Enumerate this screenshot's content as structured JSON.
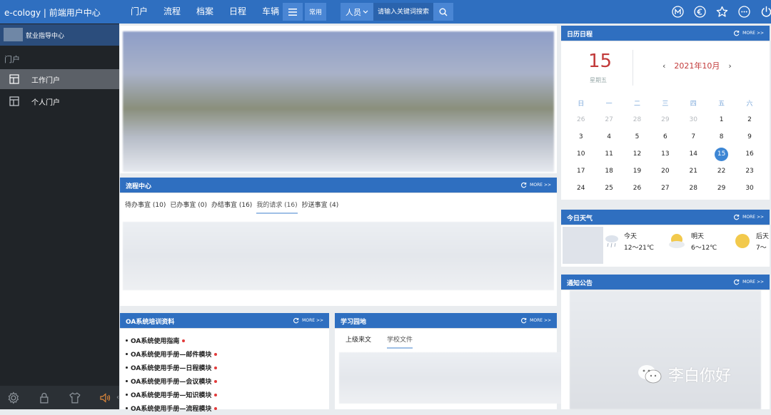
{
  "topbar": {
    "brand": "e-cology | 前端用户中心",
    "nav": [
      "门户",
      "流程",
      "档案",
      "日程",
      "车辆"
    ],
    "common_label": "常用",
    "search_type": "人员",
    "search_placeholder": "请输入关键词搜索",
    "icons": [
      "m-circle-icon",
      "euro-circle-icon",
      "star-icon",
      "more-circle-icon",
      "power-icon"
    ]
  },
  "sidebar": {
    "header": "就业指导中心",
    "section": "门户",
    "items": [
      {
        "label": "工作门户",
        "active": true
      },
      {
        "label": "个人门户",
        "active": false
      }
    ],
    "bottom_icons": [
      "settings-icon",
      "lock-icon",
      "shirt-icon",
      "speaker-icon"
    ]
  },
  "workflow": {
    "title": "流程中心",
    "more": "MORE >>",
    "tabs": [
      "待办事宜 (10)",
      "已办事宜 (0)",
      "办结事宜 (16)",
      "我的请求 (16)",
      "抄送事宜 (4)"
    ],
    "active_tab": 3
  },
  "oa_training": {
    "title": "OA系统培训资料",
    "more": "MORE >>",
    "items": [
      "OA系统使用指南",
      "OA系统使用手册—邮件模块",
      "OA系统使用手册—日程模块",
      "OA系统使用手册—会议模块",
      "OA系统使用手册—知识模块",
      "OA系统使用手册—流程模块"
    ]
  },
  "study": {
    "title": "学习园地",
    "more": "MORE >>",
    "tabs": [
      "上级来文",
      "学校文件"
    ],
    "active_tab": 1
  },
  "calendar": {
    "title": "日历日程",
    "more": "MORE >>",
    "day": "15",
    "weekday": "星期五",
    "month_label": "2021年10月",
    "weekheads": [
      "日",
      "一",
      "二",
      "三",
      "四",
      "五",
      "六"
    ],
    "weeks": [
      [
        "26",
        "27",
        "28",
        "29",
        "30",
        "1",
        "2"
      ],
      [
        "3",
        "4",
        "5",
        "6",
        "7",
        "8",
        "9"
      ],
      [
        "10",
        "11",
        "12",
        "13",
        "14",
        "15",
        "16"
      ],
      [
        "17",
        "18",
        "19",
        "20",
        "21",
        "22",
        "23"
      ],
      [
        "24",
        "25",
        "26",
        "27",
        "28",
        "29",
        "30"
      ]
    ],
    "muted_first_row_count": 5,
    "today": "15"
  },
  "weather": {
    "title": "今日天气",
    "more": "MORE >>",
    "days": [
      {
        "name": "今天",
        "range": "12～21℃",
        "icon": "rain-cloud-icon"
      },
      {
        "name": "明天",
        "range": "6～12℃",
        "icon": "sun-cloud-icon"
      },
      {
        "name": "后天",
        "range": "7～",
        "icon": "sun-icon"
      }
    ]
  },
  "notice": {
    "title": "通知公告",
    "more": "MORE >>"
  },
  "watermark": {
    "text": "李白你好"
  }
}
